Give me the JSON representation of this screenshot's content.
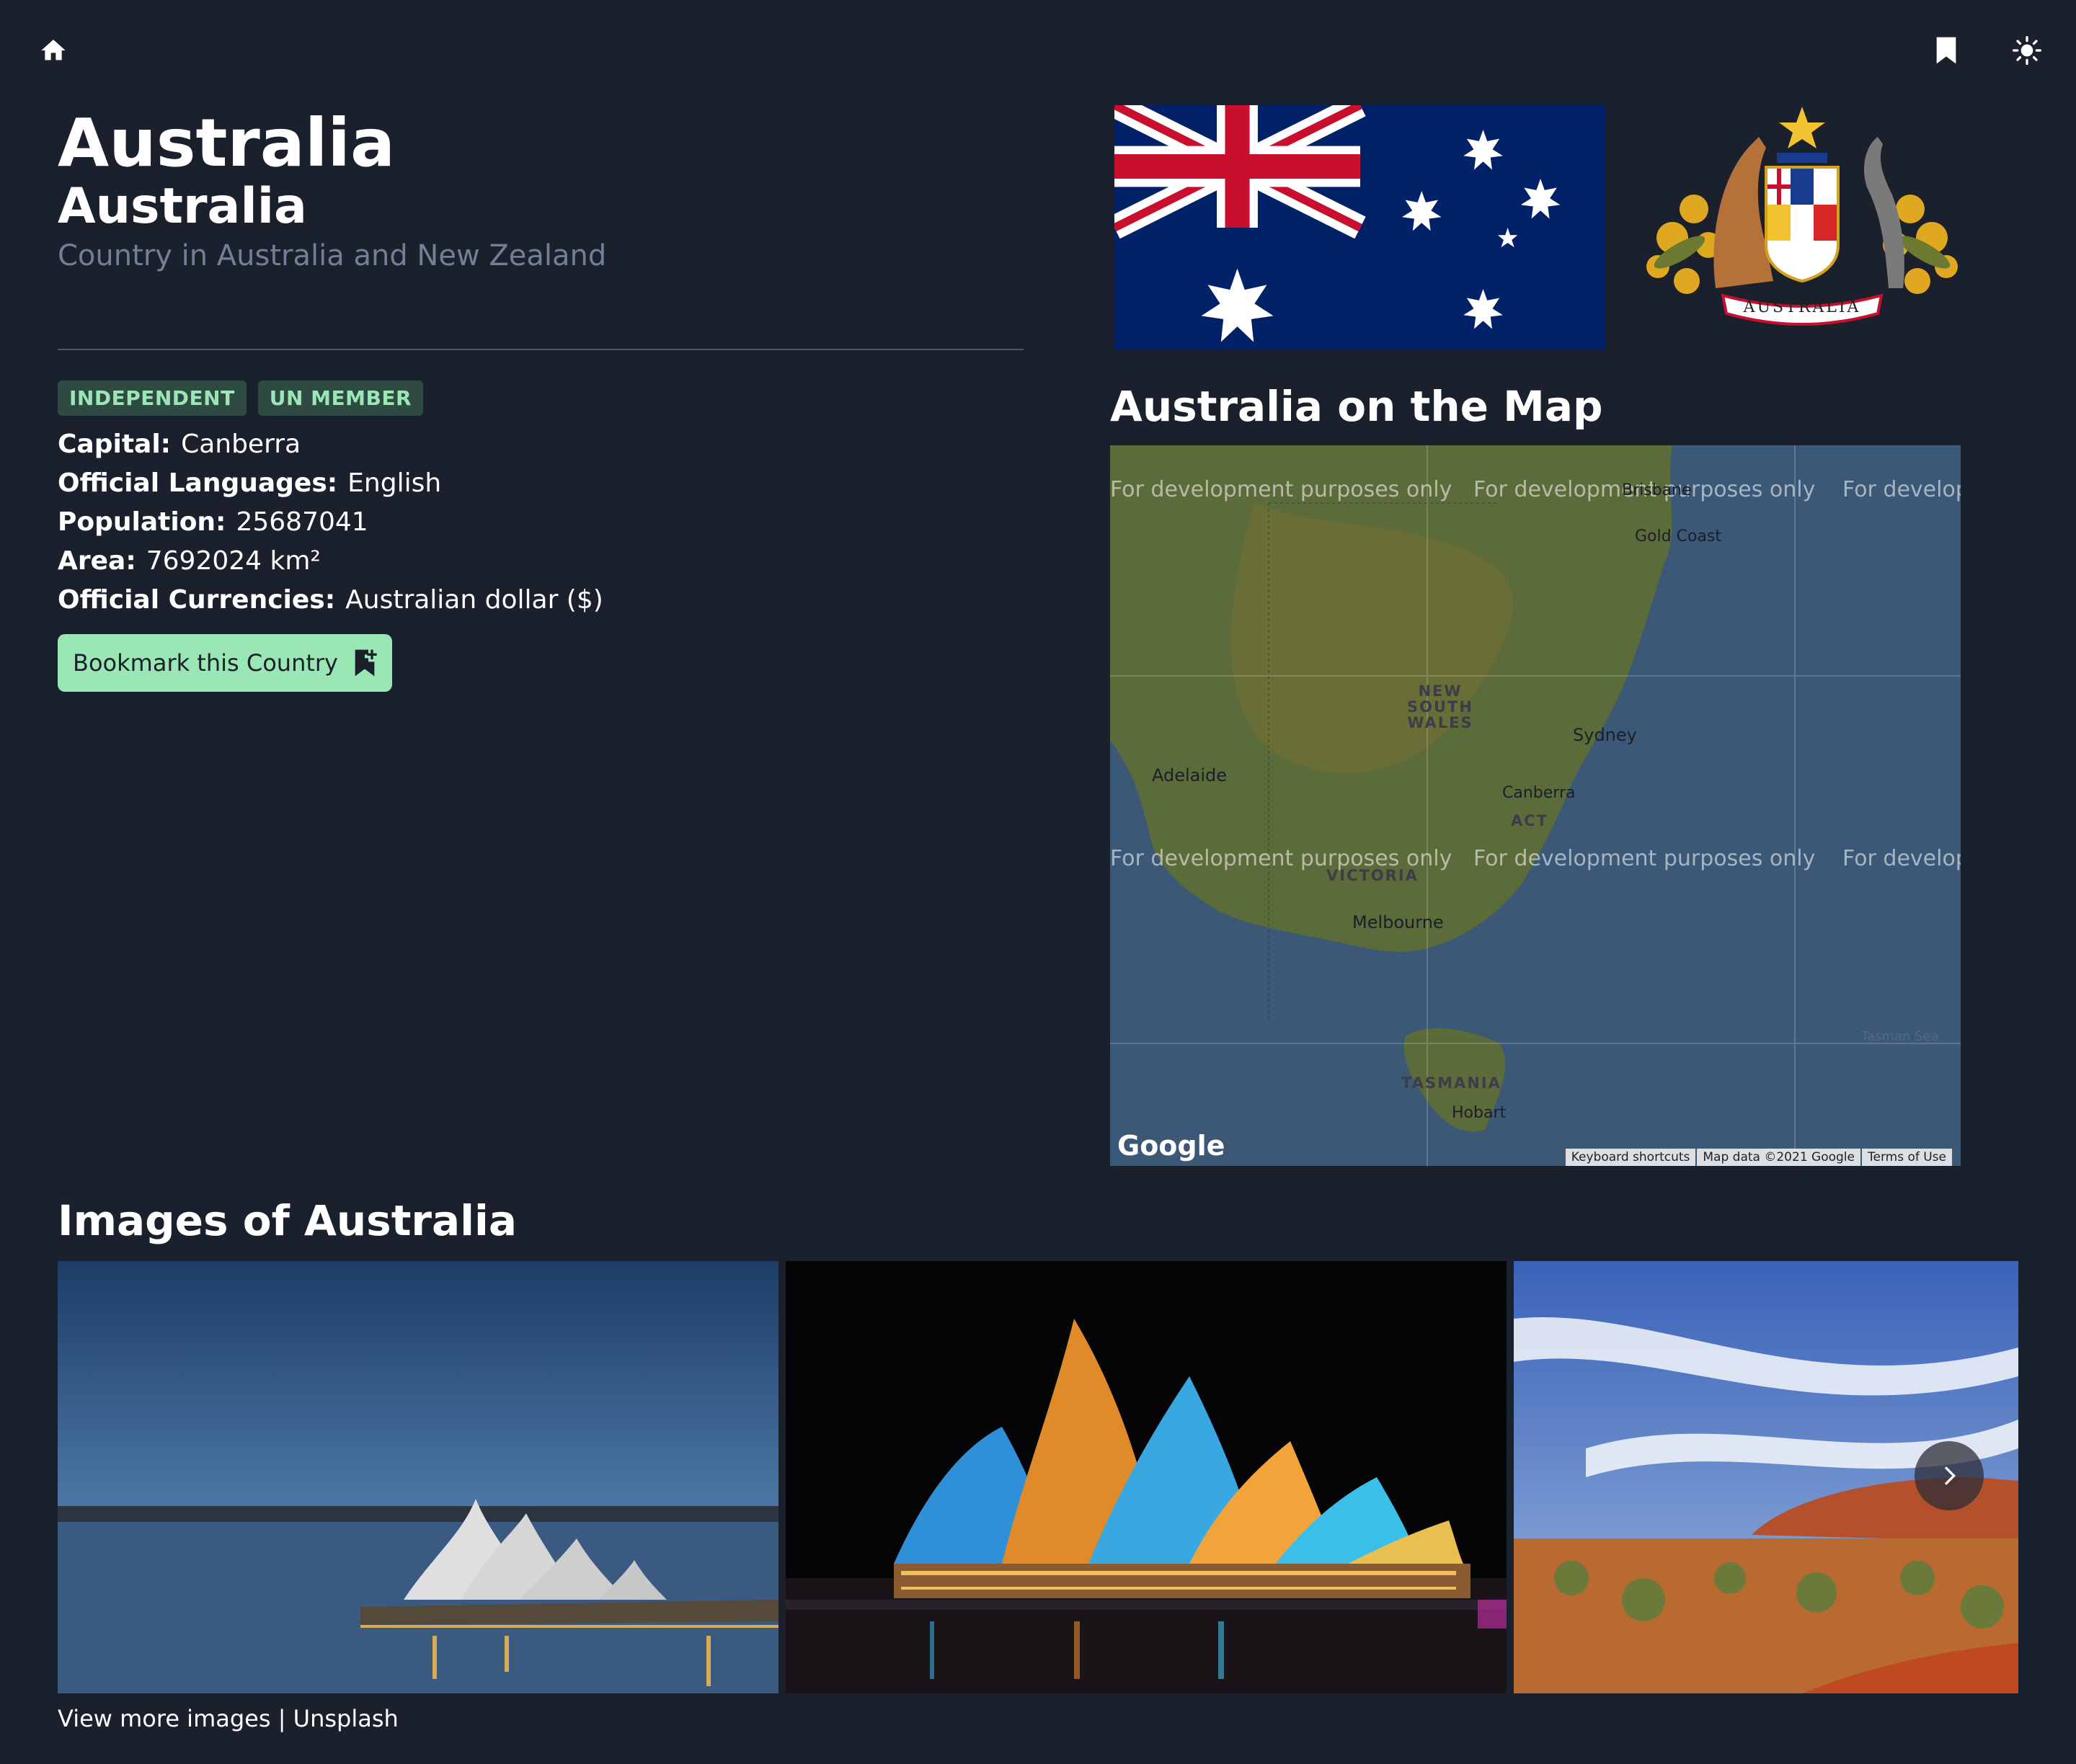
{
  "nav": {
    "home_icon": "home-icon",
    "bookmarks_icon": "bookmark-icon",
    "theme_icon": "sun-icon"
  },
  "country": {
    "name": "Australia",
    "official_name": "Australia",
    "description": "Country in Australia and New Zealand",
    "badges": [
      "INDEPENDENT",
      "UN MEMBER"
    ],
    "facts": [
      {
        "key": "Capital:",
        "value": "Canberra"
      },
      {
        "key": "Official Languages:",
        "value": "English"
      },
      {
        "key": "Population:",
        "value": "25687041"
      },
      {
        "key": "Area:",
        "value": "7692024 km²"
      },
      {
        "key": "Official Currencies:",
        "value": "Australian dollar ($)"
      }
    ],
    "bookmark_button": "Bookmark this Country"
  },
  "coat_of_arms": {
    "banner": "AUSTRALIA"
  },
  "map": {
    "title": "Australia on the Map",
    "watermark": "For development purposes only",
    "cities": [
      "Brisbane",
      "Gold Coast",
      "Sydney",
      "Canberra",
      "Adelaide",
      "Melbourne",
      "Hobart"
    ],
    "regions": [
      "NEW SOUTH WALES",
      "ACT",
      "VICTORIA",
      "TASMANIA",
      "Tasman Sea"
    ],
    "footer": [
      "Keyboard shortcuts",
      "Map data ©2021 Google",
      "Terms of Use"
    ],
    "logo": "Google"
  },
  "images": {
    "title": "Images of Australia",
    "more_label": "View more images",
    "separator": "|",
    "source": "Unsplash"
  },
  "colors": {
    "background": "#1a202c",
    "accent": "#9ae6b4",
    "badge_bg": "#2e4a42",
    "muted": "#718096"
  }
}
